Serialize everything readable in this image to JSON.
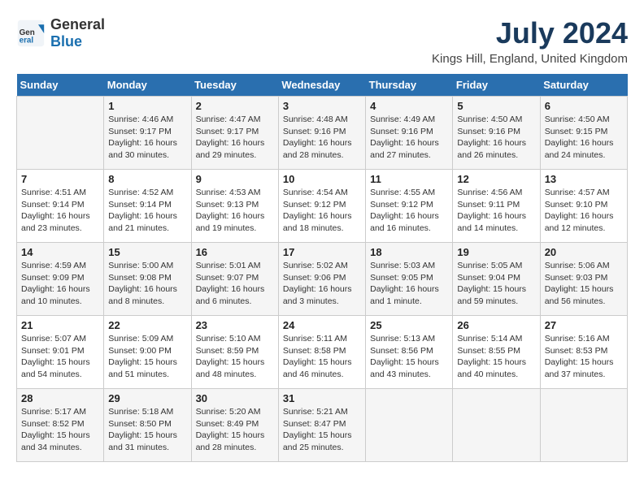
{
  "header": {
    "logo_general": "General",
    "logo_blue": "Blue",
    "title": "July 2024",
    "subtitle": "Kings Hill, England, United Kingdom"
  },
  "calendar": {
    "days_of_week": [
      "Sunday",
      "Monday",
      "Tuesday",
      "Wednesday",
      "Thursday",
      "Friday",
      "Saturday"
    ],
    "weeks": [
      [
        {
          "day": "",
          "info": ""
        },
        {
          "day": "1",
          "info": "Sunrise: 4:46 AM\nSunset: 9:17 PM\nDaylight: 16 hours\nand 30 minutes."
        },
        {
          "day": "2",
          "info": "Sunrise: 4:47 AM\nSunset: 9:17 PM\nDaylight: 16 hours\nand 29 minutes."
        },
        {
          "day": "3",
          "info": "Sunrise: 4:48 AM\nSunset: 9:16 PM\nDaylight: 16 hours\nand 28 minutes."
        },
        {
          "day": "4",
          "info": "Sunrise: 4:49 AM\nSunset: 9:16 PM\nDaylight: 16 hours\nand 27 minutes."
        },
        {
          "day": "5",
          "info": "Sunrise: 4:50 AM\nSunset: 9:16 PM\nDaylight: 16 hours\nand 26 minutes."
        },
        {
          "day": "6",
          "info": "Sunrise: 4:50 AM\nSunset: 9:15 PM\nDaylight: 16 hours\nand 24 minutes."
        }
      ],
      [
        {
          "day": "7",
          "info": "Sunrise: 4:51 AM\nSunset: 9:14 PM\nDaylight: 16 hours\nand 23 minutes."
        },
        {
          "day": "8",
          "info": "Sunrise: 4:52 AM\nSunset: 9:14 PM\nDaylight: 16 hours\nand 21 minutes."
        },
        {
          "day": "9",
          "info": "Sunrise: 4:53 AM\nSunset: 9:13 PM\nDaylight: 16 hours\nand 19 minutes."
        },
        {
          "day": "10",
          "info": "Sunrise: 4:54 AM\nSunset: 9:12 PM\nDaylight: 16 hours\nand 18 minutes."
        },
        {
          "day": "11",
          "info": "Sunrise: 4:55 AM\nSunset: 9:12 PM\nDaylight: 16 hours\nand 16 minutes."
        },
        {
          "day": "12",
          "info": "Sunrise: 4:56 AM\nSunset: 9:11 PM\nDaylight: 16 hours\nand 14 minutes."
        },
        {
          "day": "13",
          "info": "Sunrise: 4:57 AM\nSunset: 9:10 PM\nDaylight: 16 hours\nand 12 minutes."
        }
      ],
      [
        {
          "day": "14",
          "info": "Sunrise: 4:59 AM\nSunset: 9:09 PM\nDaylight: 16 hours\nand 10 minutes."
        },
        {
          "day": "15",
          "info": "Sunrise: 5:00 AM\nSunset: 9:08 PM\nDaylight: 16 hours\nand 8 minutes."
        },
        {
          "day": "16",
          "info": "Sunrise: 5:01 AM\nSunset: 9:07 PM\nDaylight: 16 hours\nand 6 minutes."
        },
        {
          "day": "17",
          "info": "Sunrise: 5:02 AM\nSunset: 9:06 PM\nDaylight: 16 hours\nand 3 minutes."
        },
        {
          "day": "18",
          "info": "Sunrise: 5:03 AM\nSunset: 9:05 PM\nDaylight: 16 hours\nand 1 minute."
        },
        {
          "day": "19",
          "info": "Sunrise: 5:05 AM\nSunset: 9:04 PM\nDaylight: 15 hours\nand 59 minutes."
        },
        {
          "day": "20",
          "info": "Sunrise: 5:06 AM\nSunset: 9:03 PM\nDaylight: 15 hours\nand 56 minutes."
        }
      ],
      [
        {
          "day": "21",
          "info": "Sunrise: 5:07 AM\nSunset: 9:01 PM\nDaylight: 15 hours\nand 54 minutes."
        },
        {
          "day": "22",
          "info": "Sunrise: 5:09 AM\nSunset: 9:00 PM\nDaylight: 15 hours\nand 51 minutes."
        },
        {
          "day": "23",
          "info": "Sunrise: 5:10 AM\nSunset: 8:59 PM\nDaylight: 15 hours\nand 48 minutes."
        },
        {
          "day": "24",
          "info": "Sunrise: 5:11 AM\nSunset: 8:58 PM\nDaylight: 15 hours\nand 46 minutes."
        },
        {
          "day": "25",
          "info": "Sunrise: 5:13 AM\nSunset: 8:56 PM\nDaylight: 15 hours\nand 43 minutes."
        },
        {
          "day": "26",
          "info": "Sunrise: 5:14 AM\nSunset: 8:55 PM\nDaylight: 15 hours\nand 40 minutes."
        },
        {
          "day": "27",
          "info": "Sunrise: 5:16 AM\nSunset: 8:53 PM\nDaylight: 15 hours\nand 37 minutes."
        }
      ],
      [
        {
          "day": "28",
          "info": "Sunrise: 5:17 AM\nSunset: 8:52 PM\nDaylight: 15 hours\nand 34 minutes."
        },
        {
          "day": "29",
          "info": "Sunrise: 5:18 AM\nSunset: 8:50 PM\nDaylight: 15 hours\nand 31 minutes."
        },
        {
          "day": "30",
          "info": "Sunrise: 5:20 AM\nSunset: 8:49 PM\nDaylight: 15 hours\nand 28 minutes."
        },
        {
          "day": "31",
          "info": "Sunrise: 5:21 AM\nSunset: 8:47 PM\nDaylight: 15 hours\nand 25 minutes."
        },
        {
          "day": "",
          "info": ""
        },
        {
          "day": "",
          "info": ""
        },
        {
          "day": "",
          "info": ""
        }
      ]
    ]
  }
}
